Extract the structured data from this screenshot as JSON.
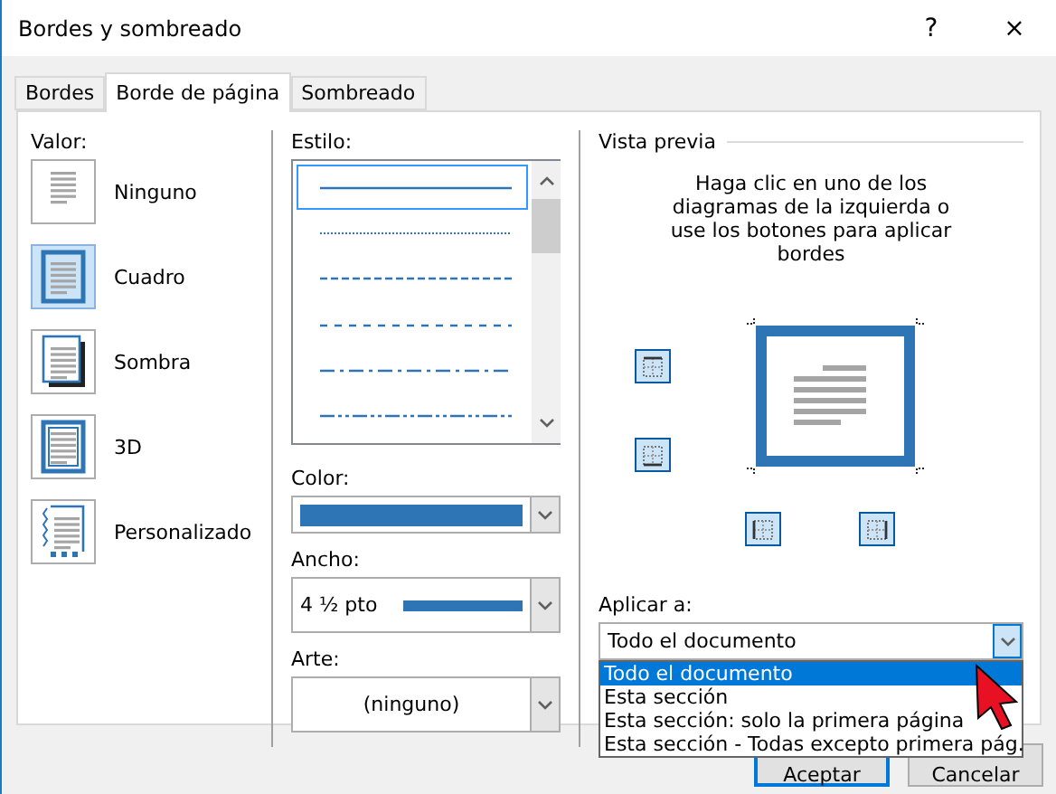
{
  "window": {
    "title": "Bordes y sombreado",
    "help": "?",
    "close": "×"
  },
  "tabs": [
    {
      "label": "Bordes",
      "selected": false
    },
    {
      "label": "Borde de página",
      "selected": true
    },
    {
      "label": "Sombreado",
      "selected": false
    }
  ],
  "valor": {
    "label": "Valor:",
    "options": [
      {
        "label": "Ninguno",
        "kind": "none",
        "selected": false
      },
      {
        "label": "Cuadro",
        "kind": "box",
        "selected": true
      },
      {
        "label": "Sombra",
        "kind": "shadow",
        "selected": false
      },
      {
        "label": "3D",
        "kind": "depth",
        "selected": false
      },
      {
        "label": "Personalizado",
        "kind": "custom",
        "selected": false
      }
    ]
  },
  "estilo": {
    "label": "Estilo:",
    "styles": [
      {
        "kind": "solid",
        "selected": true
      },
      {
        "kind": "dotted",
        "selected": false
      },
      {
        "kind": "dashed",
        "selected": false
      },
      {
        "kind": "long-dash",
        "selected": false
      },
      {
        "kind": "dash-dot",
        "selected": false
      },
      {
        "kind": "dash-dot-dot",
        "selected": false
      }
    ]
  },
  "color": {
    "label": "Color:",
    "color": "#2e75b6"
  },
  "ancho": {
    "label": "Ancho:",
    "value": "4 ½ pto"
  },
  "arte": {
    "label": "Arte:",
    "value": "(ninguno)"
  },
  "preview": {
    "title": "Vista previa",
    "hint": "Haga clic en uno de los diagramas de la izquierda o use los botones para aplicar bordes",
    "edges": [
      {
        "kind": "top",
        "on": true
      },
      {
        "kind": "bottom",
        "on": true
      },
      {
        "kind": "left",
        "on": true
      },
      {
        "kind": "right",
        "on": true
      }
    ]
  },
  "apply_to": {
    "label": "Aplicar a:",
    "value": "Todo el documento",
    "expanded": true,
    "options": [
      {
        "label": "Todo el documento",
        "selected": true
      },
      {
        "label": "Esta sección",
        "selected": false
      },
      {
        "label": "Esta sección: solo la primera página",
        "selected": false
      },
      {
        "label": "Esta sección - Todas excepto primera pág.",
        "selected": false
      }
    ]
  },
  "buttons": [
    "Aceptar",
    "Cancelar"
  ]
}
